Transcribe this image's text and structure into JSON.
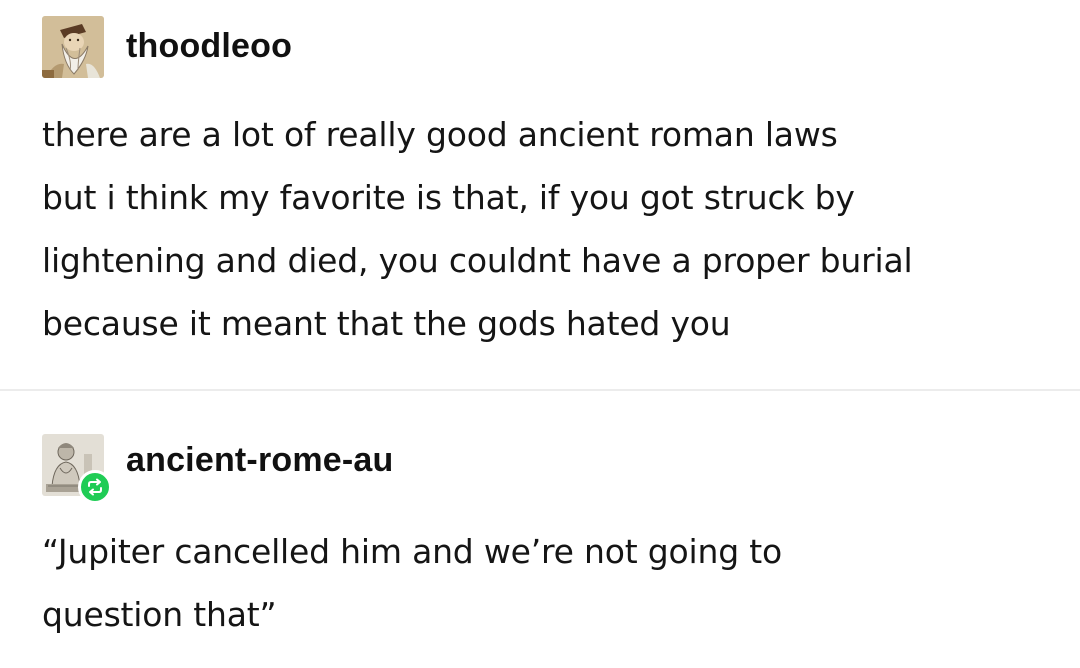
{
  "posts": [
    {
      "username": "thoodleoo",
      "avatar_icon": "bearded-man-avatar-icon",
      "text": "there are a lot of really good ancient roman laws\nbut i think my favorite is that, if you got struck by\nlightening and died, you couldnt have a proper burial\nbecause it meant that the gods hated you"
    },
    {
      "username": "ancient-rome-au",
      "avatar_icon": "roman-statue-avatar-icon",
      "badge_icon": "reblog-icon",
      "badge_color": "#1fcc55",
      "text": "“Jupiter cancelled him and we’re not going to\nquestion that”"
    }
  ]
}
